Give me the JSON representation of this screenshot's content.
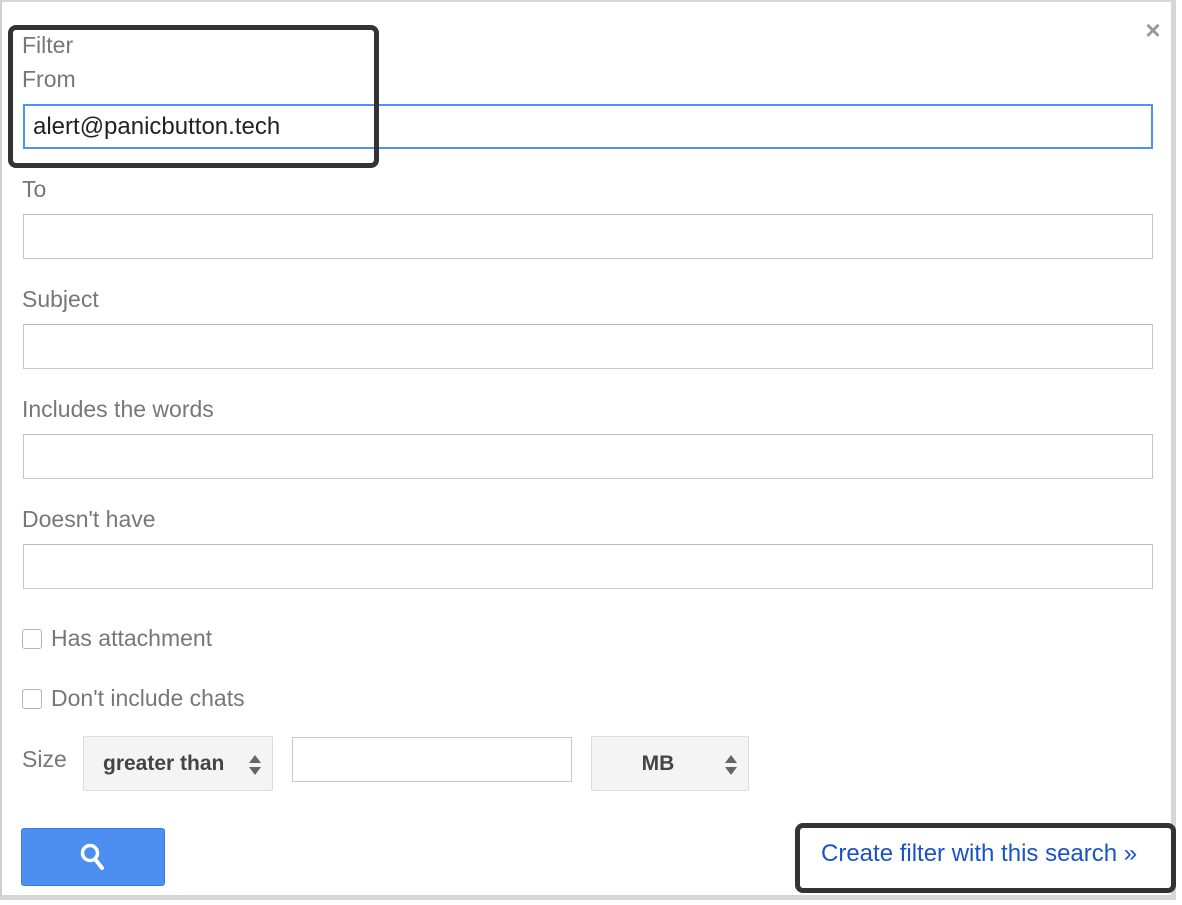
{
  "dialog": {
    "title": "Filter",
    "close_icon": "close-icon"
  },
  "fields": {
    "from": {
      "label": "From",
      "value": "alert@panicbutton.tech",
      "placeholder": ""
    },
    "to": {
      "label": "To",
      "value": "",
      "placeholder": ""
    },
    "subject": {
      "label": "Subject",
      "value": "",
      "placeholder": ""
    },
    "includes": {
      "label": "Includes the words",
      "value": "",
      "placeholder": ""
    },
    "doesnt_have": {
      "label": "Doesn't have",
      "value": "",
      "placeholder": ""
    }
  },
  "checkboxes": {
    "has_attachment": {
      "label": "Has attachment",
      "checked": false
    },
    "dont_include_chats": {
      "label": "Don't include chats",
      "checked": false
    }
  },
  "size": {
    "label": "Size",
    "comparator": "greater than",
    "value": "",
    "unit": "MB"
  },
  "actions": {
    "search_icon": "search-icon",
    "create_filter": "Create filter with this search »"
  },
  "colors": {
    "accent_blue": "#4d8ff0",
    "link_blue": "#1a53c8",
    "focus_border": "#4d90fe"
  }
}
